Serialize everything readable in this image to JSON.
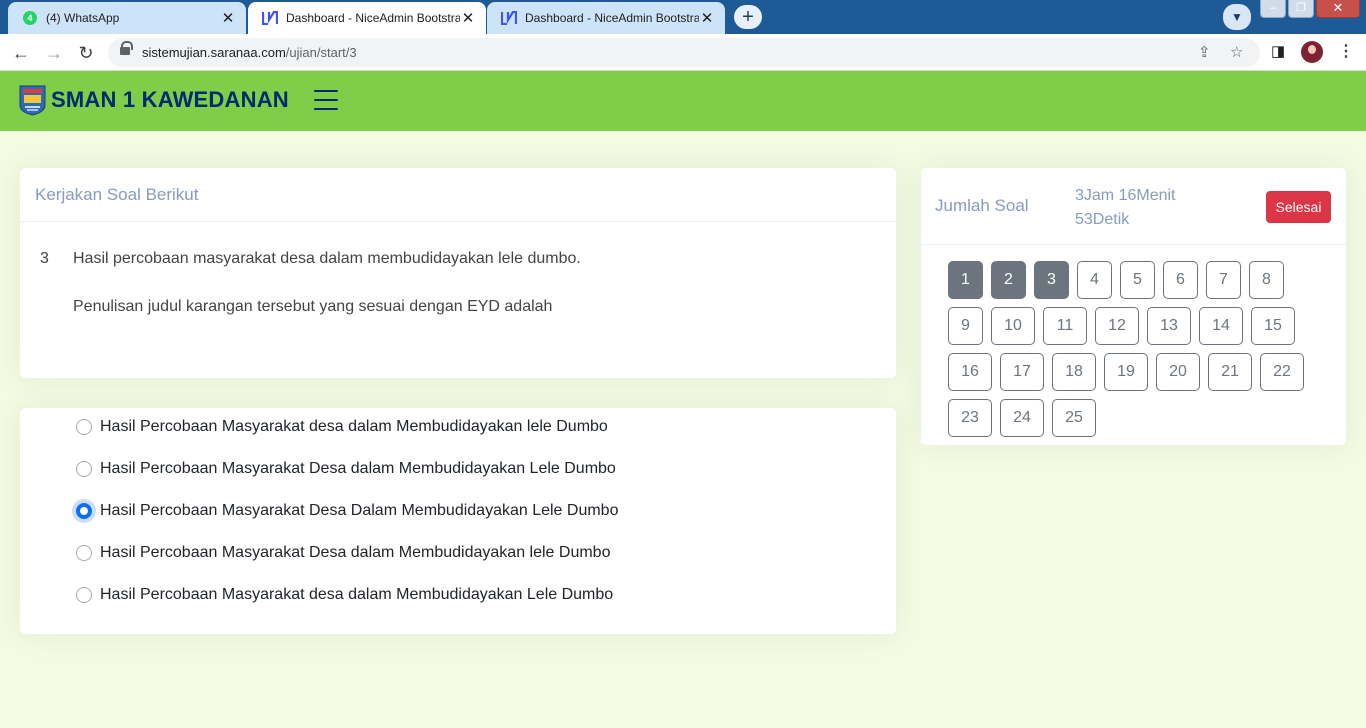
{
  "browser": {
    "tabs": [
      {
        "title": "(4) WhatsApp",
        "badge": "4",
        "active": false
      },
      {
        "title": "Dashboard - NiceAdmin Bootstrap",
        "active": true
      },
      {
        "title": "Dashboard - NiceAdmin Bootstrap",
        "active": false
      }
    ],
    "url_host": "sistemujian.saranaa.com",
    "url_path": "/ujian/start/3"
  },
  "header": {
    "school_name": "SMAN 1 KAWEDANAN"
  },
  "question_card": {
    "heading": "Kerjakan Soal Berikut",
    "number": "3",
    "line1": "Hasil percobaan masyarakat desa dalam membudidayakan lele dumbo.",
    "line2": "Penulisan judul karangan tersebut yang sesuai dengan EYD adalah"
  },
  "options": [
    {
      "label": "Hasil Percobaan Masyarakat desa dalam Membudidayakan lele Dumbo",
      "checked": false
    },
    {
      "label": "Hasil Percobaan Masyarakat Desa dalam Membudidayakan Lele Dumbo",
      "checked": false
    },
    {
      "label": "Hasil Percobaan Masyarakat Desa Dalam Membudidayakan Lele Dumbo",
      "checked": true
    },
    {
      "label": "Hasil Percobaan Masyarakat Desa dalam Membudidayakan lele Dumbo",
      "checked": false
    },
    {
      "label": "Hasil Percobaan Masyarakat desa dalam Membudidayakan Lele Dumbo",
      "checked": false
    }
  ],
  "nav_panel": {
    "label": "Jumlah Soal",
    "timer_line1": "3Jam 16Menit",
    "timer_line2": "53Detik",
    "finish_button": "Selesai",
    "questions": [
      "1",
      "2",
      "3",
      "4",
      "5",
      "6",
      "7",
      "8",
      "9",
      "10",
      "11",
      "12",
      "13",
      "14",
      "15",
      "16",
      "17",
      "18",
      "19",
      "20",
      "21",
      "22",
      "23",
      "24",
      "25"
    ],
    "answered": [
      "1",
      "2",
      "3"
    ]
  },
  "colors": {
    "header_green": "#7fcd49",
    "brand_navy": "#012970",
    "page_bg": "#f4fbe1",
    "finish_red": "#dc3545",
    "radio_blue": "#0d6efd",
    "answered_gray": "#6c757d"
  }
}
